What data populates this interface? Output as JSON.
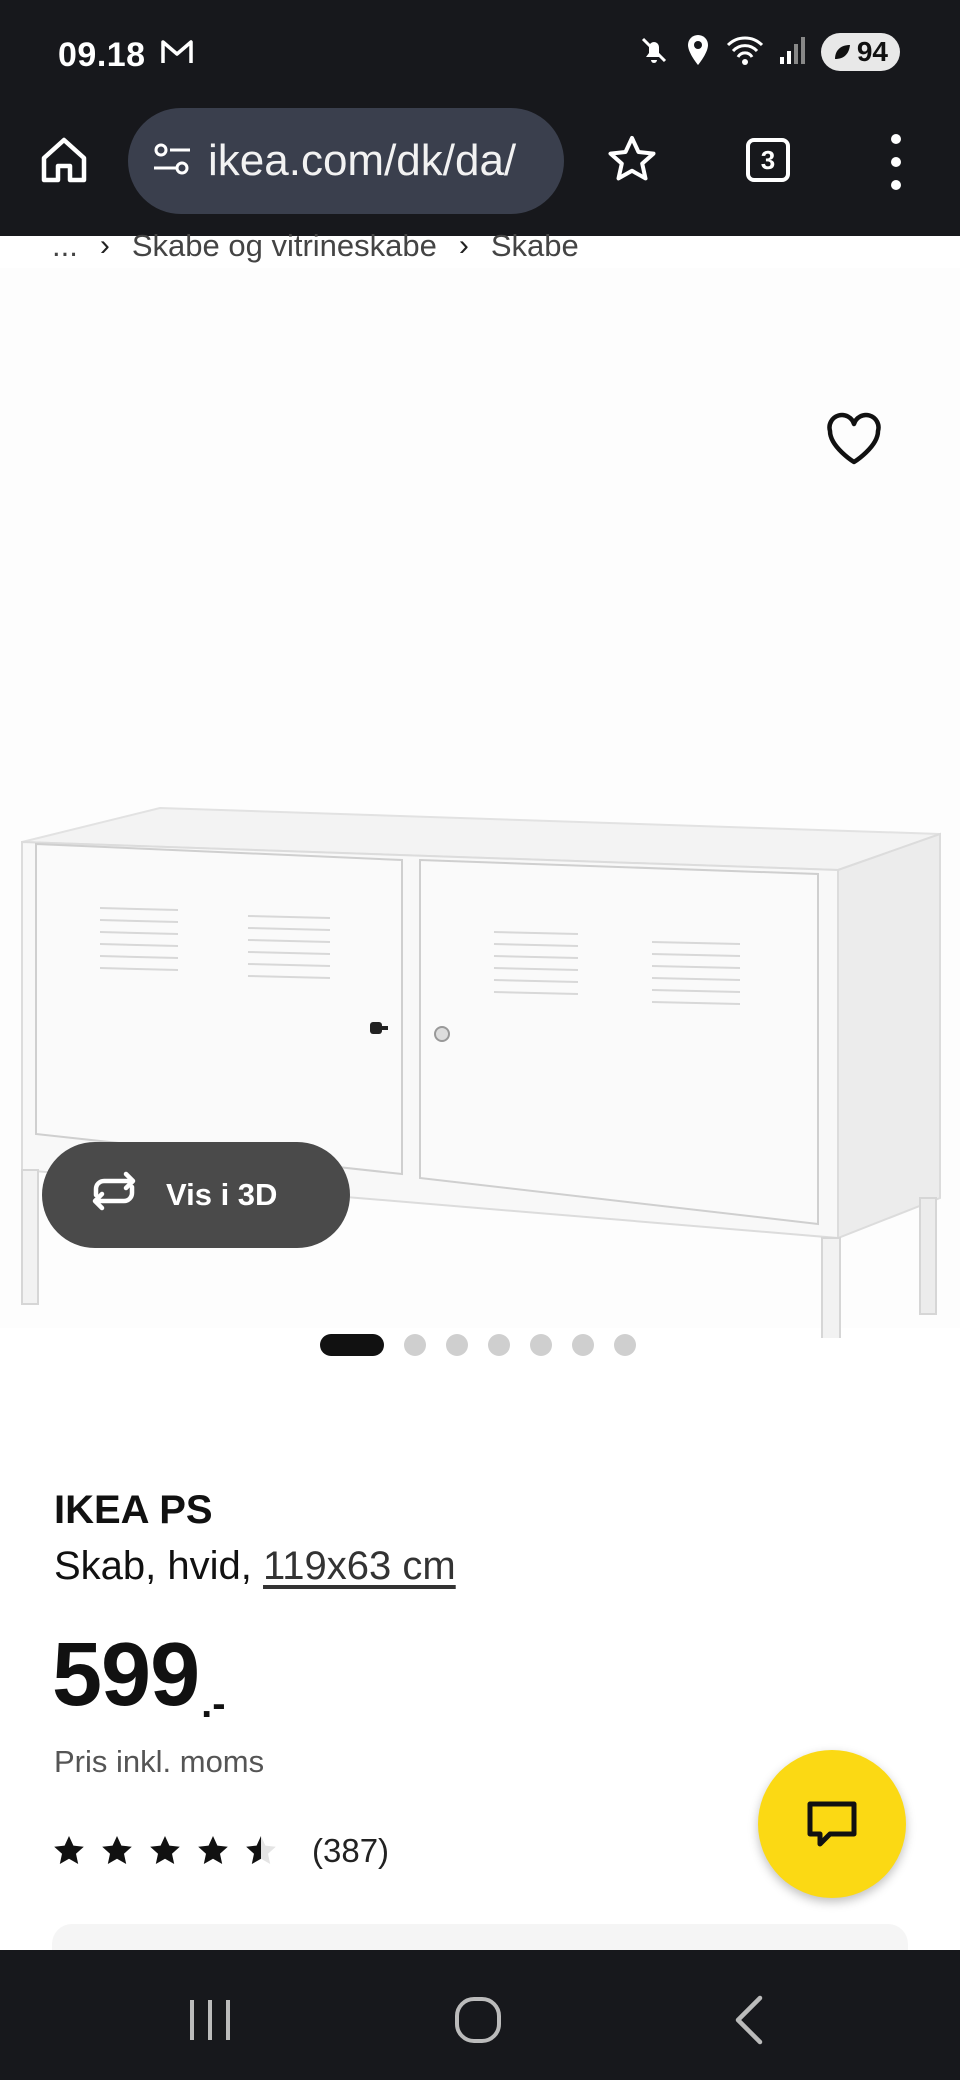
{
  "status_bar": {
    "time": "09.18",
    "battery": "94",
    "icons": [
      "mail-icon",
      "mute-icon",
      "location-icon",
      "wifi-icon",
      "signal-icon",
      "battery-icon"
    ]
  },
  "browser": {
    "url": "ikea.com/dk/da/",
    "tab_count": "3",
    "icons": [
      "home-icon",
      "site-settings-icon",
      "star-icon",
      "tabs-icon",
      "menu-icon"
    ]
  },
  "breadcrumb": {
    "items": [
      "...",
      "Skabe og vitrineskabe",
      "Skabe"
    ]
  },
  "gallery": {
    "view_3d_label": "Vis i 3D",
    "dot_count": 7,
    "active_index": 0
  },
  "product": {
    "name": "IKEA PS",
    "description_prefix": "Skab, hvid, ",
    "size_link": "119x63 cm",
    "price_main": "599",
    "price_suffix": ".-",
    "price_note": "Pris inkl. moms",
    "rating": 4.5,
    "rating_count": "(387)"
  },
  "colors": {
    "chrome": "#17181c",
    "url_pill": "#3a3f4d",
    "view3d_button": "#4a4a4a",
    "chat_button": "#fbd914"
  }
}
